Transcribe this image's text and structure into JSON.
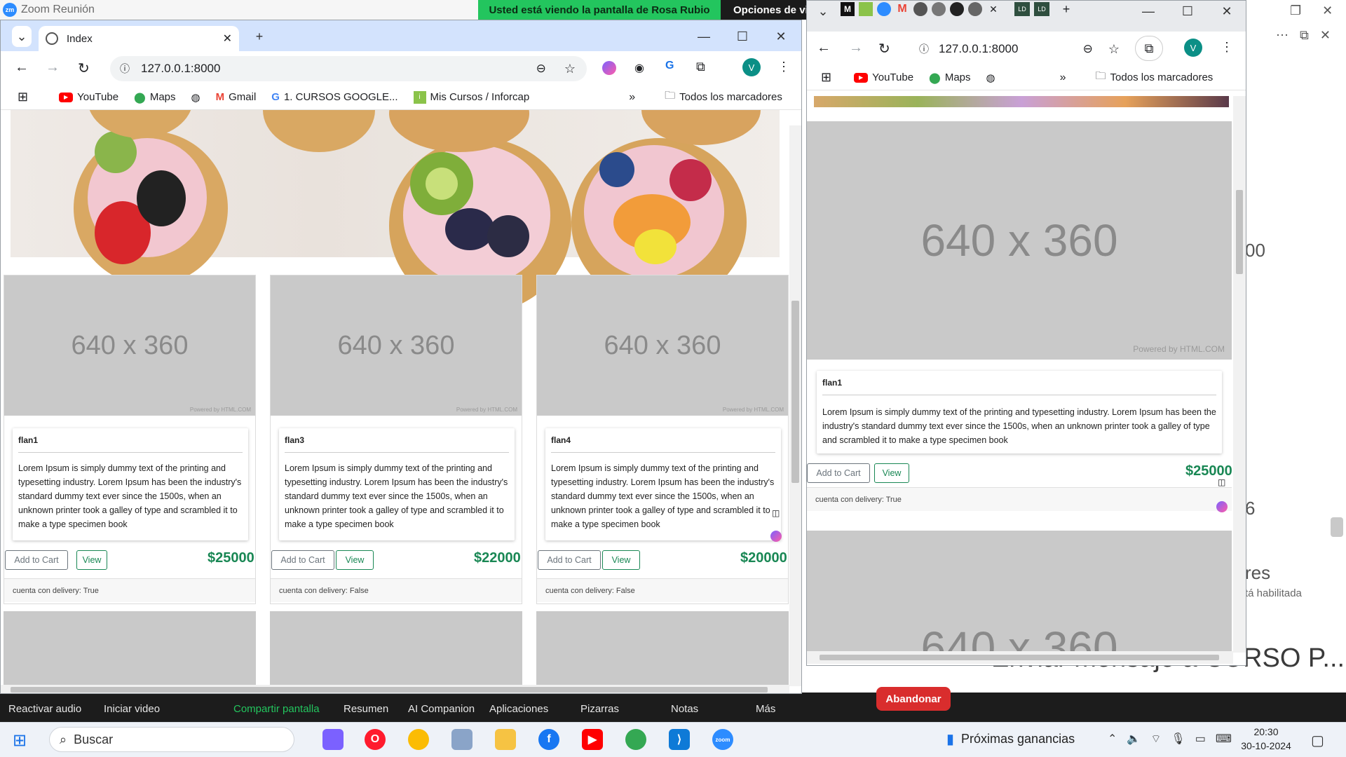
{
  "zoom": {
    "title": "Zoom Reunión",
    "share_banner": "Usted está viendo la pantalla de Rosa Rubio",
    "share_options": "Opciones de vis",
    "toolbar": [
      "Reactivar audio",
      "Iniciar video",
      "Compartir pantalla",
      "Resumen",
      "AI Companion",
      "Aplicaciones",
      "Pizarras",
      "Notas",
      "Más"
    ],
    "leave_button": "Abandonar",
    "chat_placeholder": "Enviar mensaje a CURSO P...",
    "side_partial": {
      "a": "00",
      "b": "6",
      "c": "res",
      "d": "tá habilitada"
    }
  },
  "left_browser": {
    "tab_title": "Index",
    "url": "127.0.0.1:8000",
    "profile_initial": "V",
    "bookmarks": [
      "YouTube",
      "Maps",
      "Gmail",
      "1. CURSOS GOOGLE...",
      "Mis Cursos / Inforcap"
    ],
    "all_bookmarks": "Todos los marcadores",
    "products": [
      {
        "image": "640 x 360",
        "powered": "Powered by HTML.COM",
        "name": "flan1",
        "description": "Lorem Ipsum is simply dummy text of the printing and typesetting industry. Lorem Ipsum has been the industry's standard dummy text ever since the 1500s, when an unknown printer took a galley of type and scrambled it to make a type specimen book",
        "cart": "Add to Cart",
        "view": "View",
        "price": "$25000",
        "delivery": "cuenta con delivery: True"
      },
      {
        "image": "640 x 360",
        "powered": "Powered by HTML.COM",
        "name": "flan3",
        "description": "Lorem Ipsum is simply dummy text of the printing and typesetting industry. Lorem Ipsum has been the industry's standard dummy text ever since the 1500s, when an unknown printer took a galley of type and scrambled it to make a type specimen book",
        "cart": "Add to Cart",
        "view": "View",
        "price": "$22000",
        "delivery": "cuenta con delivery: False"
      },
      {
        "image": "640 x 360",
        "powered": "Powered by HTML.COM",
        "name": "flan4",
        "description": "Lorem Ipsum is simply dummy text of the printing and typesetting industry. Lorem Ipsum has been the industry's standard dummy text ever since the 1500s, when an unknown printer took a galley of type and scrambled it to make a type specimen book",
        "cart": "Add to Cart",
        "view": "View",
        "price": "$20000",
        "delivery": "cuenta con delivery: False"
      }
    ]
  },
  "right_browser": {
    "tab_labels": [
      "M",
      "LD",
      "LD"
    ],
    "url": "127.0.0.1:8000",
    "profile_initial": "V",
    "bookmarks": [
      "YouTube",
      "Maps"
    ],
    "all_bookmarks": "Todos los marcadores",
    "product": {
      "image": "640 x 360",
      "powered": "Powered by HTML.COM",
      "name": "flan1",
      "description": "Lorem Ipsum is simply dummy text of the printing and typesetting industry. Lorem Ipsum has been the industry's standard dummy text ever since the 1500s, when an unknown printer took a galley of type and scrambled it to make a type specimen book",
      "cart": "Add to Cart",
      "view": "View",
      "price": "$25000",
      "delivery": "cuenta con delivery: True"
    },
    "next_image": "640 x 360"
  },
  "taskbar": {
    "search": "Buscar",
    "news": "Próximas ganancias",
    "time": "20:30",
    "date": "30-10-2024",
    "zoom_label": "zoom"
  }
}
